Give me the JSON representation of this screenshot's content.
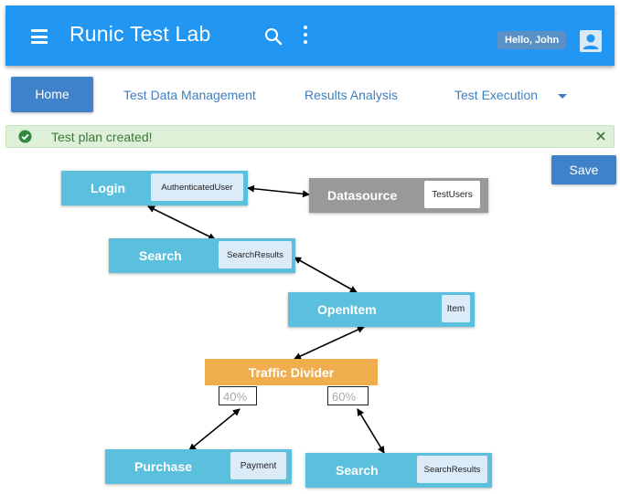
{
  "app": {
    "title": "Runic Test Lab",
    "greeting": "Hello, John"
  },
  "nav": {
    "tabs": [
      "Home",
      "Test Data Management",
      "Results Analysis",
      "Test Execution"
    ]
  },
  "alert": {
    "message": "Test plan created!",
    "type": "success"
  },
  "toolbar": {
    "save_label": "Save"
  },
  "diagram": {
    "nodes": [
      {
        "label": "Login",
        "tag": "AuthenticatedUser"
      },
      {
        "label": "Datasource",
        "tag": "TestUsers"
      },
      {
        "label": "Search",
        "tag": "SearchResults"
      },
      {
        "label": "OpenItem",
        "tag": "Item"
      },
      {
        "label": "Traffic Divider"
      },
      {
        "label": "Purchase",
        "tag": "Payment"
      },
      {
        "label": "Search",
        "tag": "SearchResults"
      }
    ],
    "splits": [
      "40%",
      "60%"
    ]
  },
  "colors": {
    "appbar": "#2196f3",
    "primary_button": "#3f82c9",
    "node": "#5bc0de",
    "datasource_node": "#999999",
    "divider_node": "#f0ad4e",
    "alert_bg": "#dff0d8",
    "alert_text": "#3c763d"
  },
  "icons": [
    "menu-icon",
    "search-icon",
    "more-vert-icon",
    "account-icon",
    "chevron-down-icon",
    "check-circle-icon",
    "close-icon"
  ]
}
